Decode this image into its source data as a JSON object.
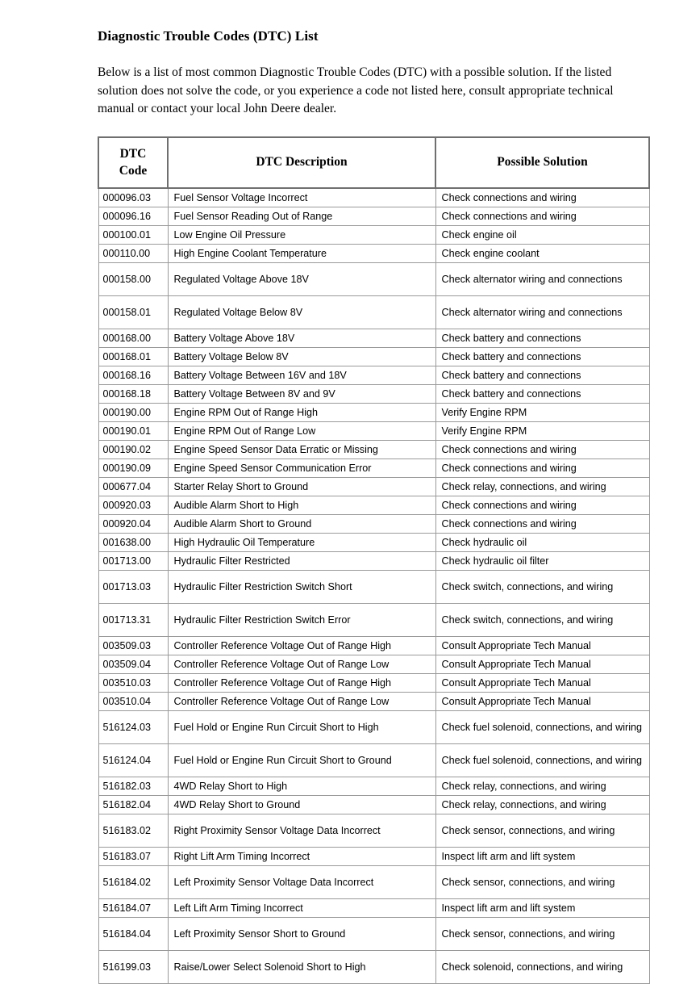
{
  "document": {
    "title": "Diagnostic Trouble Codes (DTC) List",
    "intro": "Below is a list of most common Diagnostic Trouble Codes (DTC) with a possible solution. If the listed solution does not solve the code, or you experience a code not listed here, consult appropriate technical manual or contact your local John Deere dealer."
  },
  "table": {
    "headers": {
      "code": "DTC Code",
      "code_line1": "DTC",
      "code_line2": "Code",
      "description": "DTC Description",
      "solution": "Possible Solution"
    },
    "rows": [
      {
        "code": "000096.03",
        "description": "Fuel Sensor Voltage Incorrect",
        "solution": "Check connections and wiring"
      },
      {
        "code": "000096.16",
        "description": "Fuel Sensor Reading Out of Range",
        "solution": "Check connections and wiring"
      },
      {
        "code": "000100.01",
        "description": "Low Engine Oil Pressure",
        "solution": "Check engine oil"
      },
      {
        "code": "000110.00",
        "description": "High Engine Coolant Temperature",
        "solution": "Check engine coolant"
      },
      {
        "code": "000158.00",
        "description": "Regulated Voltage Above 18V",
        "solution": "Check alternator wiring and connections"
      },
      {
        "code": "000158.01",
        "description": "Regulated Voltage Below 8V",
        "solution": "Check alternator wiring and connections"
      },
      {
        "code": "000168.00",
        "description": "Battery Voltage Above 18V",
        "solution": "Check battery and connections"
      },
      {
        "code": "000168.01",
        "description": "Battery Voltage Below 8V",
        "solution": "Check battery and connections"
      },
      {
        "code": "000168.16",
        "description": "Battery Voltage Between 16V and 18V",
        "solution": "Check battery and connections"
      },
      {
        "code": "000168.18",
        "description": "Battery Voltage Between 8V and 9V",
        "solution": "Check battery and connections"
      },
      {
        "code": "000190.00",
        "description": "Engine RPM Out of Range High",
        "solution": "Verify Engine RPM"
      },
      {
        "code": "000190.01",
        "description": "Engine RPM Out of Range Low",
        "solution": "Verify Engine RPM"
      },
      {
        "code": "000190.02",
        "description": "Engine Speed Sensor Data Erratic or Missing",
        "solution": "Check connections and wiring"
      },
      {
        "code": "000190.09",
        "description": "Engine Speed Sensor Communication Error",
        "solution": "Check connections and wiring"
      },
      {
        "code": "000677.04",
        "description": "Starter Relay Short to Ground",
        "solution": "Check relay, connections, and wiring"
      },
      {
        "code": "000920.03",
        "description": "Audible Alarm Short to High",
        "solution": "Check connections and wiring"
      },
      {
        "code": "000920.04",
        "description": "Audible Alarm Short to Ground",
        "solution": "Check connections and wiring"
      },
      {
        "code": "001638.00",
        "description": "High Hydraulic Oil Temperature",
        "solution": "Check hydraulic oil"
      },
      {
        "code": "001713.00",
        "description": "Hydraulic Filter Restricted",
        "solution": "Check hydraulic oil filter"
      },
      {
        "code": "001713.03",
        "description": "Hydraulic Filter Restriction Switch Short",
        "solution": "Check switch, connections, and wiring"
      },
      {
        "code": "001713.31",
        "description": "Hydraulic Filter Restriction Switch Error",
        "solution": "Check switch, connections, and wiring"
      },
      {
        "code": "003509.03",
        "description": "Controller Reference Voltage Out of Range High",
        "solution": "Consult Appropriate Tech Manual"
      },
      {
        "code": "003509.04",
        "description": "Controller Reference Voltage Out of Range Low",
        "solution": "Consult Appropriate Tech Manual"
      },
      {
        "code": "003510.03",
        "description": "Controller Reference Voltage Out of Range High",
        "solution": "Consult Appropriate Tech Manual"
      },
      {
        "code": "003510.04",
        "description": "Controller Reference Voltage Out of Range Low",
        "solution": "Consult Appropriate Tech Manual"
      },
      {
        "code": "516124.03",
        "description": "Fuel Hold or Engine Run Circuit Short to High",
        "solution": "Check fuel solenoid, connections, and wiring"
      },
      {
        "code": "516124.04",
        "description": "Fuel Hold or Engine Run Circuit Short to Ground",
        "solution": "Check fuel solenoid, connections, and wiring"
      },
      {
        "code": "516182.03",
        "description": "4WD Relay Short to High",
        "solution": "Check relay, connections, and wiring"
      },
      {
        "code": "516182.04",
        "description": "4WD Relay Short to Ground",
        "solution": "Check relay, connections, and wiring"
      },
      {
        "code": "516183.02",
        "description": "Right Proximity Sensor Voltage Data Incorrect",
        "solution": "Check sensor, connections, and wiring"
      },
      {
        "code": "516183.07",
        "description": "Right Lift Arm Timing Incorrect",
        "solution": "Inspect lift arm and lift system"
      },
      {
        "code": "516184.02",
        "description": "Left Proximity Sensor Voltage Data Incorrect",
        "solution": "Check sensor, connections, and wiring"
      },
      {
        "code": "516184.07",
        "description": "Left Lift Arm Timing Incorrect",
        "solution": "Inspect lift arm and lift system"
      },
      {
        "code": "516184.04",
        "description": "Left Proximity Sensor Short to Ground",
        "solution": "Check sensor, connections, and wiring"
      },
      {
        "code": "516199.03",
        "description": "Raise/Lower Select Solenoid Short to High",
        "solution": "Check solenoid, connections, and wiring"
      }
    ]
  }
}
